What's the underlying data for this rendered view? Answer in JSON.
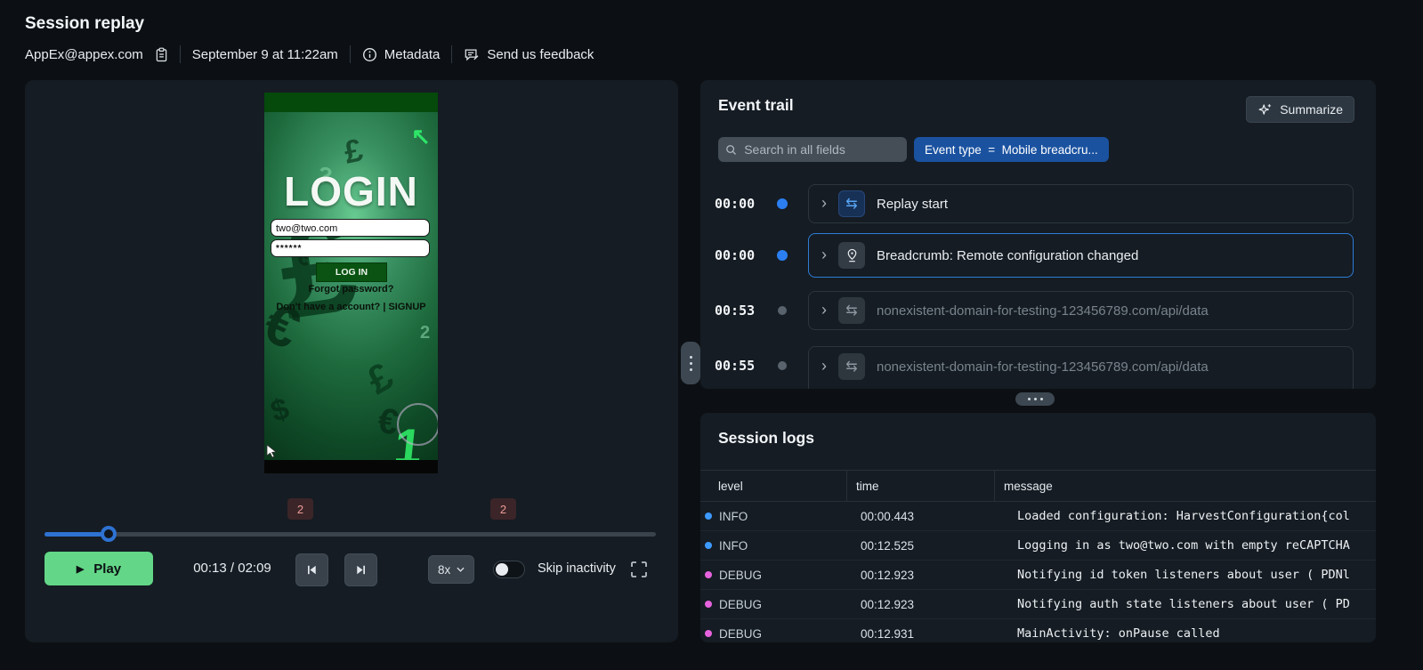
{
  "header": {
    "title": "Session replay",
    "user": "AppEx@appex.com",
    "date": "September 9 at 11:22am",
    "metadata_label": "Metadata",
    "feedback_label": "Send us feedback"
  },
  "icons": {
    "chevron_right": "›",
    "swap": "⇆",
    "play": "▶"
  },
  "player": {
    "play_label": "Play",
    "time_display": "00:13 / 02:09",
    "speed_label": "8x",
    "skip_inactivity_label": "Skip inactivity",
    "skip_inactivity_enabled": false,
    "progress_percent": 10.5,
    "timeline_badges": [
      "2",
      "2"
    ],
    "phone": {
      "login_title": "LOGIN",
      "email_value": "two@two.com",
      "password_value": "******",
      "login_button": "LOG IN",
      "forgot_password": "Forgot password?",
      "signup_text": "Don't have a account? | SIGNUP",
      "texture": [
        "£",
        "↖",
        "1",
        "€",
        "£",
        "?",
        "$",
        "2",
        "€",
        "£",
        "7",
        "€"
      ]
    }
  },
  "event_trail": {
    "title": "Event trail",
    "summarize_label": "Summarize",
    "search_placeholder": "Search in all fields",
    "filter_chip": "Event type  =  Mobile breadcru...",
    "events": [
      {
        "time": "00:00",
        "label": "Replay start",
        "icon": "replay-swap-icon",
        "dot_color": "#2b7ff2",
        "selected": false
      },
      {
        "time": "00:00",
        "label": "Breadcrumb: Remote configuration changed",
        "icon": "breadcrumb-pin-icon",
        "dot_color": "#2b7ff2",
        "selected": true
      },
      {
        "time": "00:53",
        "label": "nonexistent-domain-for-testing-123456789.com/api/data",
        "icon": "network-swap-icon",
        "dot_color": "#59636d",
        "selected": false
      },
      {
        "time": "00:55",
        "label": "nonexistent-domain-for-testing-123456789.com/api/data",
        "icon": "network-swap-icon",
        "dot_color": "#59636d",
        "selected": false
      }
    ]
  },
  "session_logs": {
    "title": "Session logs",
    "columns": [
      "level",
      "time",
      "message"
    ],
    "rows": [
      {
        "level": "INFO",
        "time": "00:00.443",
        "message": "Loaded configuration: HarvestConfiguration{col",
        "dot_color": "#3d9aff"
      },
      {
        "level": "INFO",
        "time": "00:12.525",
        "message": "Logging in as two@two.com with empty reCAPTCHA",
        "dot_color": "#3d9aff"
      },
      {
        "level": "DEBUG",
        "time": "00:12.923",
        "message": "Notifying id token listeners about user ( PDNl",
        "dot_color": "#e663de"
      },
      {
        "level": "DEBUG",
        "time": "00:12.923",
        "message": "Notifying auth state listeners about user ( PD",
        "dot_color": "#e663de"
      },
      {
        "level": "DEBUG",
        "time": "00:12.931",
        "message": "MainActivity: onPause called",
        "dot_color": "#e663de"
      }
    ]
  },
  "colors": {
    "accent_blue": "#2e72d2",
    "selected_border": "#2e7cd6",
    "chip_blue": "#1a52a0",
    "play_green": "#63d787",
    "info_dot": "#3d9aff",
    "debug_dot": "#e663de",
    "badge_bg": "#3b2528",
    "badge_text": "#eb9b96"
  }
}
